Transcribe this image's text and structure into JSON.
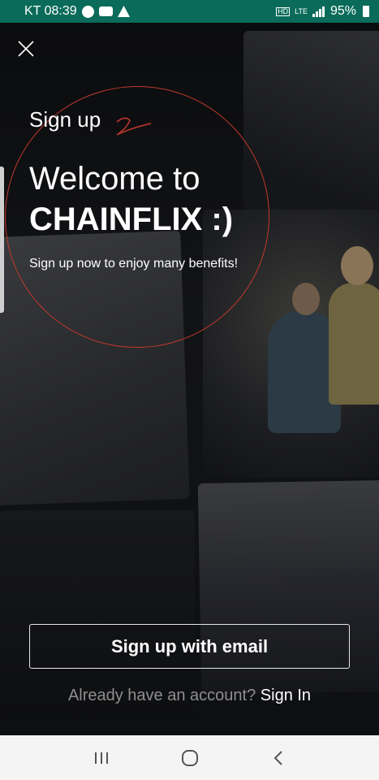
{
  "status_bar": {
    "carrier_time": "KT 08:39",
    "network": "LTE",
    "battery": "95%"
  },
  "icons": {
    "close": "close-icon",
    "recents": "recents-icon",
    "home": "home-icon",
    "back": "back-icon"
  },
  "content": {
    "heading_small": "Sign up",
    "welcome": "Welcome to",
    "brand": "CHAINFLIX :)",
    "subtitle": "Sign up now to enjoy many benefits!"
  },
  "actions": {
    "email_button": "Sign up with email",
    "signin_prompt": "Already have an account?",
    "signin_link": "Sign In"
  },
  "colors": {
    "status_bar_bg": "#0a6b5a",
    "annotation_red": "#c0392b",
    "button_border": "#e6e6e6"
  }
}
